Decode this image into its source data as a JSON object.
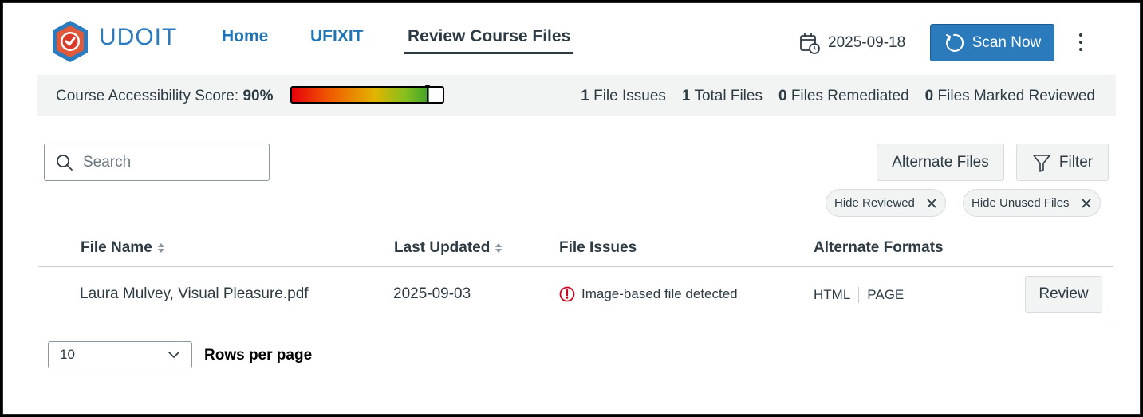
{
  "app": {
    "name": "UDOIT"
  },
  "nav": {
    "home": "Home",
    "ufixit": "UFIXIT",
    "review": "Review Course Files"
  },
  "header": {
    "date": "2025-09-18",
    "scan_label": "Scan Now"
  },
  "score": {
    "label": "Course Accessibility Score:",
    "value": "90%",
    "fraction": 0.9
  },
  "stats": [
    {
      "count": "1",
      "label": "File Issues"
    },
    {
      "count": "1",
      "label": "Total Files"
    },
    {
      "count": "0",
      "label": "Files Remediated"
    },
    {
      "count": "0",
      "label": "Files Marked Reviewed"
    }
  ],
  "search": {
    "placeholder": "Search",
    "value": ""
  },
  "toolbar": {
    "alternate_files": "Alternate Files",
    "filter": "Filter"
  },
  "chips": [
    {
      "label": "Hide Reviewed"
    },
    {
      "label": "Hide Unused Files"
    }
  ],
  "table": {
    "headers": {
      "file_name": "File Name",
      "last_updated": "Last Updated",
      "file_issues": "File Issues",
      "alternate_formats": "Alternate Formats"
    },
    "rows": [
      {
        "file_name": "Laura Mulvey, Visual Pleasure.pdf",
        "last_updated": "2025-09-03",
        "issue": "Image-based file detected",
        "formats": [
          "HTML",
          "PAGE"
        ],
        "action": "Review"
      }
    ]
  },
  "pagination": {
    "rows_value": "10",
    "rows_label": "Rows per page"
  },
  "colors": {
    "primary": "#2b7abc",
    "nav": "#1f73b7",
    "text": "#2d3b45",
    "error": "#d0021b",
    "bar_bg": "#f2f4f4"
  }
}
